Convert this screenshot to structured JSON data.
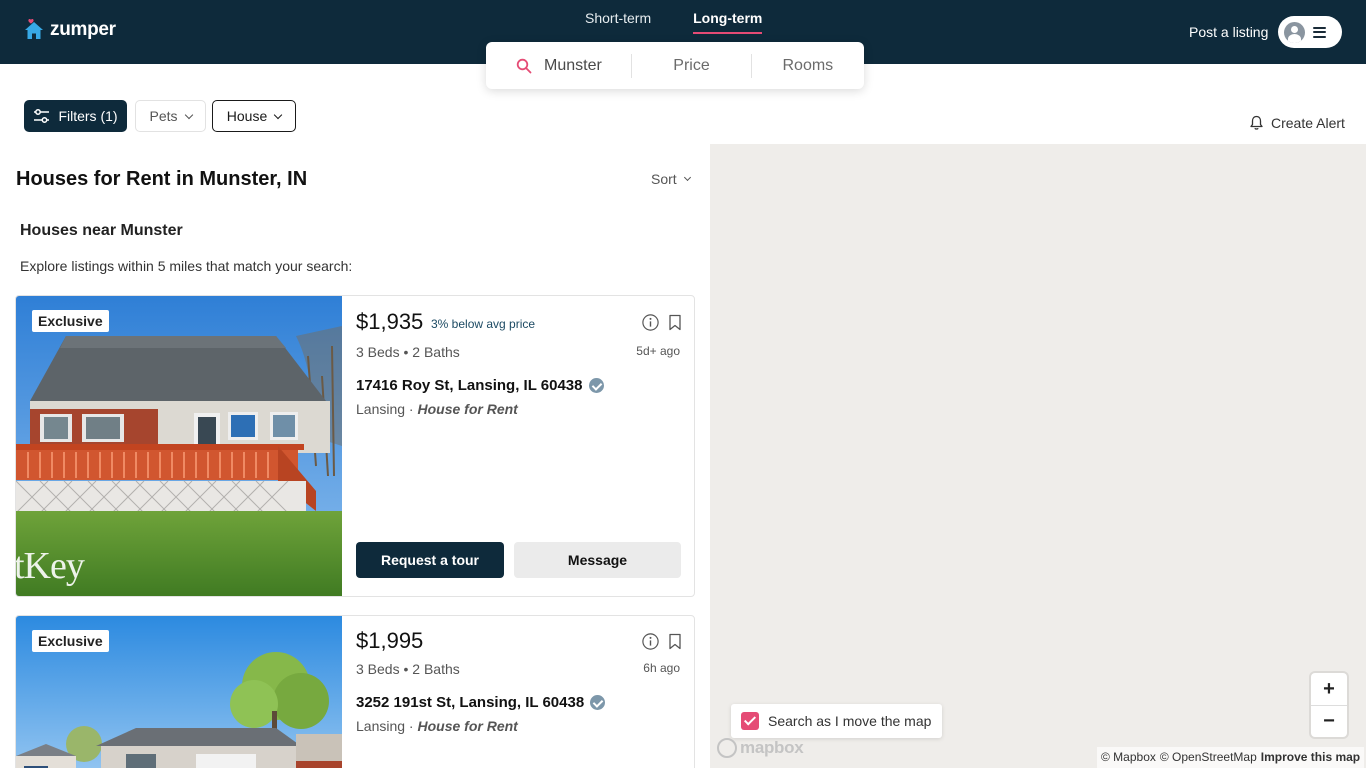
{
  "header": {
    "logo_text": "zumper",
    "tabs": [
      {
        "label": "Short-term",
        "active": false
      },
      {
        "label": "Long-term",
        "active": true
      }
    ],
    "post_listing": "Post a listing"
  },
  "search": {
    "location": "Munster",
    "price": "Price",
    "rooms": "Rooms"
  },
  "filters": {
    "filters_label": "Filters (1)",
    "pets_label": "Pets",
    "house_label": "House",
    "create_alert": "Create Alert"
  },
  "results": {
    "title": "Houses for Rent in Munster, IN",
    "sort_label": "Sort",
    "section_title": "Houses near Munster",
    "section_subtitle": "Explore listings within 5 miles that match your search:"
  },
  "listings": [
    {
      "badge": "Exclusive",
      "price": "$1,935",
      "price_note": "3% below avg price",
      "beds_baths": "3 Beds • 2 Baths",
      "posted": "5d+ ago",
      "address": "17416 Roy St, Lansing, IL 60438",
      "neighborhood": "Lansing",
      "type": "House for Rent",
      "watermark": "tKey",
      "tour_label": "Request a tour",
      "message_label": "Message"
    },
    {
      "badge": "Exclusive",
      "price": "$1,995",
      "beds_baths": "3 Beds • 2 Baths",
      "posted": "6h ago",
      "address": "3252 191st St, Lansing, IL 60438",
      "neighborhood": "Lansing",
      "type": "House for Rent"
    }
  ],
  "map": {
    "search_as_move": "Search as I move the map",
    "search_as_move_checked": true,
    "zoom_in": "+",
    "zoom_out": "−",
    "logo": "mapbox",
    "attribution_mapbox": "© Mapbox",
    "attribution_osm": "© OpenStreetMap",
    "improve": "Improve this map"
  },
  "icons": {
    "logo": "house-icon",
    "search": "search-icon",
    "filters": "sliders-icon",
    "alert": "bell-icon",
    "info": "info-icon",
    "save": "bookmark-icon",
    "verified": "check-badge-icon"
  },
  "colors": {
    "header_bg": "#0e2a3b",
    "accent": "#e54b75",
    "map_bg": "#efedea"
  }
}
